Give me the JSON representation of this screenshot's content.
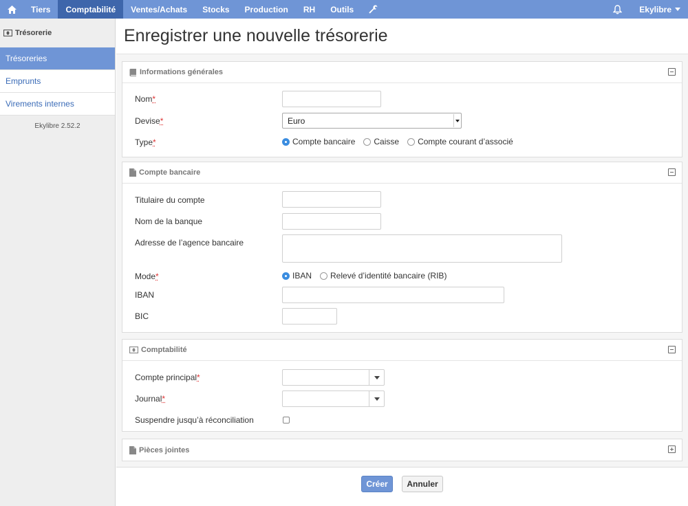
{
  "nav": {
    "items": [
      "Tiers",
      "Comptabilité",
      "Ventes/Achats",
      "Stocks",
      "Production",
      "RH",
      "Outils"
    ],
    "active": "Comptabilité",
    "user": "Ekylibre"
  },
  "sidebar": {
    "header": "Trésorerie",
    "items": [
      "Trésoreries",
      "Emprunts",
      "Virements internes"
    ],
    "version": "Ekylibre 2.52.2"
  },
  "page": {
    "title": "Enregistrer une nouvelle trésorerie"
  },
  "general": {
    "title": "Informations générales",
    "name_label": "Nom",
    "currency_label": "Devise",
    "currency_value": "Euro",
    "type_label": "Type",
    "type_options": [
      "Compte bancaire",
      "Caisse",
      "Compte courant d’associé"
    ],
    "type_selected": "Compte bancaire"
  },
  "bank": {
    "title": "Compte bancaire",
    "holder_label": "Titulaire du compte",
    "bank_name_label": "Nom de la banque",
    "agency_address_label": "Adresse de l’agence bancaire",
    "mode_label": "Mode",
    "mode_options": [
      "IBAN",
      "Relevé d’identité bancaire (RIB)"
    ],
    "mode_selected": "IBAN",
    "iban_label": "IBAN",
    "bic_label": "BIC"
  },
  "accounting": {
    "title": "Comptabilité",
    "main_account_label": "Compte principal",
    "journal_label": "Journal",
    "suspend_label": "Suspendre jusqu’à réconciliation",
    "suspend_checked": false
  },
  "attachments": {
    "title": "Pièces jointes"
  },
  "actions": {
    "create": "Créer",
    "cancel": "Annuler"
  },
  "required_marker": "*",
  "colors": {
    "nav": "#6f95d6",
    "nav_active": "#3e66ab",
    "link": "#3a6bb7",
    "required": "#dd3333",
    "radio_selected": "#3b8de0"
  }
}
